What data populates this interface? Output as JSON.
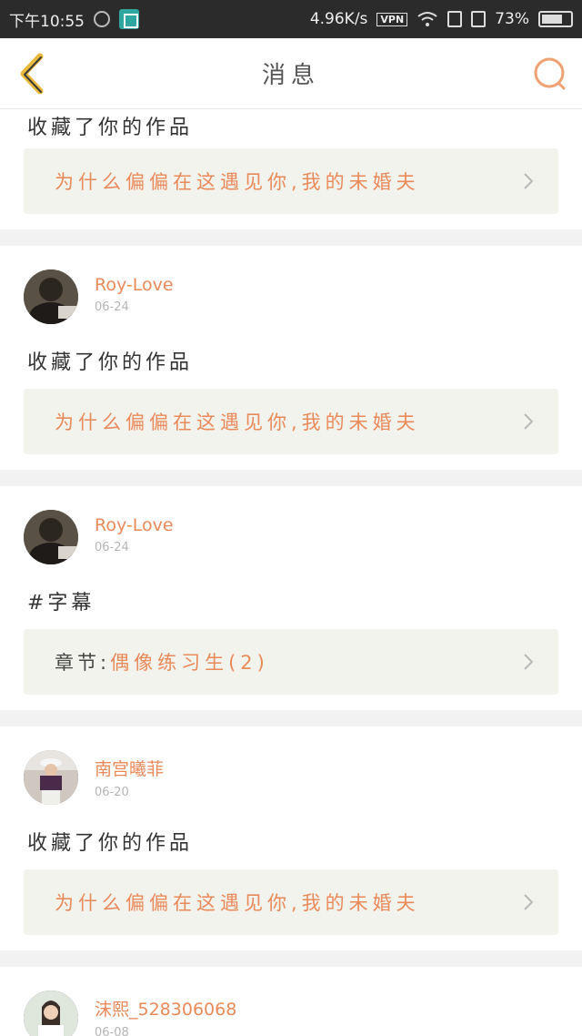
{
  "status_bar": {
    "time": "下午10:55",
    "speed": "4.96K/s",
    "vpn": "VPN",
    "battery": "73%",
    "battery_level": 0.73
  },
  "header": {
    "title": "消息"
  },
  "items": [
    {
      "message": "收藏了你的作品",
      "link_text": "为什么偏偏在这遇见你,我的未婚夫"
    },
    {
      "username": "Roy-Love",
      "date": "06-24",
      "message": "收藏了你的作品",
      "link_text": "为什么偏偏在这遇见你,我的未婚夫"
    },
    {
      "username": "Roy-Love",
      "date": "06-24",
      "message": "#字幕",
      "link_label": "章节:",
      "link_text": "偶像练习生(2)"
    },
    {
      "username": "南宫曦菲",
      "date": "06-20",
      "message": "收藏了你的作品",
      "link_text": "为什么偏偏在这遇见你,我的未婚夫"
    },
    {
      "username": "沫熙_528306068",
      "date": "06-08"
    }
  ],
  "colors": {
    "accent": "#e98a5a",
    "back_arrow": "#e8b93a",
    "link_bg": "#f3f3ee"
  }
}
